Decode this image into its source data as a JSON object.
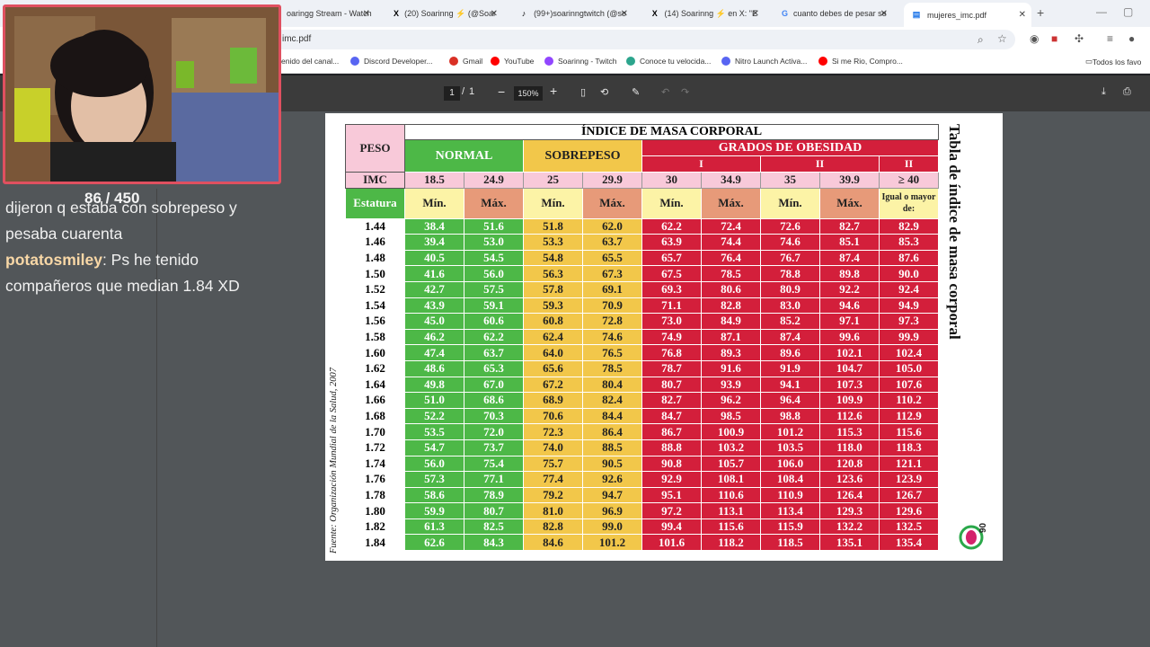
{
  "tabs": [
    {
      "title": "oaringg Stream - Watch",
      "icon": "twitch-icon"
    },
    {
      "title": "(20) Soarinng ⚡ (@Soar",
      "icon": "x-logo-icon"
    },
    {
      "title": "(99+)soarinngtwitch (@so",
      "icon": "tiktok-icon"
    },
    {
      "title": "(14) Soarinng ⚡ en X: \"E",
      "icon": "x-logo-icon"
    },
    {
      "title": "cuanto debes de pesar se",
      "icon": "google-icon"
    },
    {
      "title": "mujeres_imc.pdf",
      "icon": "pdf-icon",
      "active": true
    }
  ],
  "address": {
    "url": "imc.pdf"
  },
  "bookmarks": [
    {
      "label": "enido del canal...",
      "color": "#7a5af5"
    },
    {
      "label": "Discord Developer...",
      "color": "#5865f2"
    },
    {
      "label": "Gmail",
      "color": "#d93025"
    },
    {
      "label": "YouTube",
      "color": "#ff0000"
    },
    {
      "label": "Soarinng - Twitch",
      "color": "#9146ff"
    },
    {
      "label": "Conoce tu velocida...",
      "color": "#2ca58d"
    },
    {
      "label": "Nitro Launch Activa...",
      "color": "#5865f2"
    },
    {
      "label": "Si me Rio, Compro...",
      "color": "#ff0000"
    }
  ],
  "bookmarks_folder": "Todos los favo",
  "pdf_toolbar": {
    "page": "1",
    "of": "/",
    "total": "1",
    "zoom": "150%",
    "minus": "−",
    "plus": "+"
  },
  "table": {
    "title": "ÍNDICE DE MASA CORPORAL",
    "peso": "PESO",
    "normal": "NORMAL",
    "sobrepeso": "SOBREPESO",
    "obesidad": "GRADOS DE OBESIDAD",
    "grades": [
      "I",
      "II",
      "II"
    ],
    "imc_label": "IMC",
    "imc_values": [
      "18.5",
      "24.9",
      "25",
      "29.9",
      "30",
      "34.9",
      "35",
      "39.9",
      "≥ 40"
    ],
    "estatura_label": "Estatura",
    "minmax": [
      "Mín.",
      "Máx.",
      "Mín.",
      "Máx.",
      "Mín.",
      "Máx.",
      "Mín.",
      "Máx."
    ],
    "last_header": "Igual o mayor de:",
    "rows": [
      [
        "1.44",
        "38.4",
        "51.6",
        "51.8",
        "62.0",
        "62.2",
        "72.4",
        "72.6",
        "82.7",
        "82.9"
      ],
      [
        "1.46",
        "39.4",
        "53.0",
        "53.3",
        "63.7",
        "63.9",
        "74.4",
        "74.6",
        "85.1",
        "85.3"
      ],
      [
        "1.48",
        "40.5",
        "54.5",
        "54.8",
        "65.5",
        "65.7",
        "76.4",
        "76.7",
        "87.4",
        "87.6"
      ],
      [
        "1.50",
        "41.6",
        "56.0",
        "56.3",
        "67.3",
        "67.5",
        "78.5",
        "78.8",
        "89.8",
        "90.0"
      ],
      [
        "1.52",
        "42.7",
        "57.5",
        "57.8",
        "69.1",
        "69.3",
        "80.6",
        "80.9",
        "92.2",
        "92.4"
      ],
      [
        "1.54",
        "43.9",
        "59.1",
        "59.3",
        "70.9",
        "71.1",
        "82.8",
        "83.0",
        "94.6",
        "94.9"
      ],
      [
        "1.56",
        "45.0",
        "60.6",
        "60.8",
        "72.8",
        "73.0",
        "84.9",
        "85.2",
        "97.1",
        "97.3"
      ],
      [
        "1.58",
        "46.2",
        "62.2",
        "62.4",
        "74.6",
        "74.9",
        "87.1",
        "87.4",
        "99.6",
        "99.9"
      ],
      [
        "1.60",
        "47.4",
        "63.7",
        "64.0",
        "76.5",
        "76.8",
        "89.3",
        "89.6",
        "102.1",
        "102.4"
      ],
      [
        "1.62",
        "48.6",
        "65.3",
        "65.6",
        "78.5",
        "78.7",
        "91.6",
        "91.9",
        "104.7",
        "105.0"
      ],
      [
        "1.64",
        "49.8",
        "67.0",
        "67.2",
        "80.4",
        "80.7",
        "93.9",
        "94.1",
        "107.3",
        "107.6"
      ],
      [
        "1.66",
        "51.0",
        "68.6",
        "68.9",
        "82.4",
        "82.7",
        "96.2",
        "96.4",
        "109.9",
        "110.2"
      ],
      [
        "1.68",
        "52.2",
        "70.3",
        "70.6",
        "84.4",
        "84.7",
        "98.5",
        "98.8",
        "112.6",
        "112.9"
      ],
      [
        "1.70",
        "53.5",
        "72.0",
        "72.3",
        "86.4",
        "86.7",
        "100.9",
        "101.2",
        "115.3",
        "115.6"
      ],
      [
        "1.72",
        "54.7",
        "73.7",
        "74.0",
        "88.5",
        "88.8",
        "103.2",
        "103.5",
        "118.0",
        "118.3"
      ],
      [
        "1.74",
        "56.0",
        "75.4",
        "75.7",
        "90.5",
        "90.8",
        "105.7",
        "106.0",
        "120.8",
        "121.1"
      ],
      [
        "1.76",
        "57.3",
        "77.1",
        "77.4",
        "92.6",
        "92.9",
        "108.1",
        "108.4",
        "123.6",
        "123.9"
      ],
      [
        "1.78",
        "58.6",
        "78.9",
        "79.2",
        "94.7",
        "95.1",
        "110.6",
        "110.9",
        "126.4",
        "126.7"
      ],
      [
        "1.80",
        "59.9",
        "80.7",
        "81.0",
        "96.9",
        "97.2",
        "113.1",
        "113.4",
        "129.3",
        "129.6"
      ],
      [
        "1.82",
        "61.3",
        "82.5",
        "82.8",
        "99.0",
        "99.4",
        "115.6",
        "115.9",
        "132.2",
        "132.5"
      ],
      [
        "1.84",
        "62.6",
        "84.3",
        "84.6",
        "101.2",
        "101.6",
        "118.2",
        "118.5",
        "135.1",
        "135.4"
      ]
    ],
    "side_title": "Tabla de índice de masa corporal",
    "source": "Fuente: Organización Mundial de la Salud, 2007",
    "logo_text": "06"
  },
  "chat": {
    "counter": "86 / 450",
    "messages": [
      {
        "user": "",
        "text": "dijeron q estaba con sobrepeso y pesaba cuarenta"
      },
      {
        "user": "potatosmiley",
        "text": ": Ps he tenido compañeros que median 1.84 XD"
      }
    ]
  }
}
